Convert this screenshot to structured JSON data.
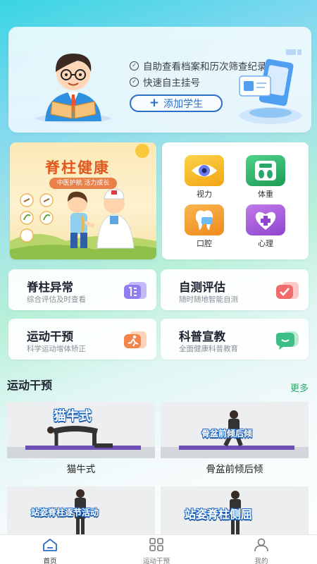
{
  "banner": {
    "lines": [
      "自助查看档案和历次筛查纪录",
      "快速自主挂号"
    ],
    "add_button": "添加学生"
  },
  "poster": {
    "title": "脊柱健康",
    "subtitle": "中医护航 活力成长"
  },
  "icon_grid": [
    {
      "label": "视力",
      "icon": "eye-icon",
      "color": "#f2b21e"
    },
    {
      "label": "体重",
      "icon": "scale-icon",
      "color": "#31b96b"
    },
    {
      "label": "口腔",
      "icon": "tooth-icon",
      "color": "#f29a2e"
    },
    {
      "label": "心理",
      "icon": "heart-icon",
      "color": "#a45cd9"
    }
  ],
  "features": [
    {
      "title": "脊柱异常",
      "sub": "综合评估及时查看"
    },
    {
      "title": "自测评估",
      "sub": "随时随地智能自测"
    },
    {
      "title": "运动干预",
      "sub": "科学运动增体矫正"
    },
    {
      "title": "科普宣教",
      "sub": "全面健康科普教育"
    }
  ],
  "section": {
    "title": "运动干预",
    "more": "更多"
  },
  "videos": [
    {
      "tag": "猫牛式",
      "caption": "猫牛式"
    },
    {
      "tag": "骨盆前倾后倾",
      "caption": "骨盆前倾后倾"
    },
    {
      "tag": "站姿脊柱逐节活动",
      "caption": ""
    },
    {
      "tag": "站姿脊柱侧屈",
      "caption": ""
    }
  ],
  "nav": [
    {
      "label": "首页",
      "icon": "home-icon"
    },
    {
      "label": "运动干预",
      "icon": "grid-icon"
    },
    {
      "label": "我的",
      "icon": "user-icon"
    }
  ],
  "colors": {
    "accent_blue": "#2c6fc7",
    "more_green": "#2aa86b",
    "poster_orange": "#e0581f"
  }
}
